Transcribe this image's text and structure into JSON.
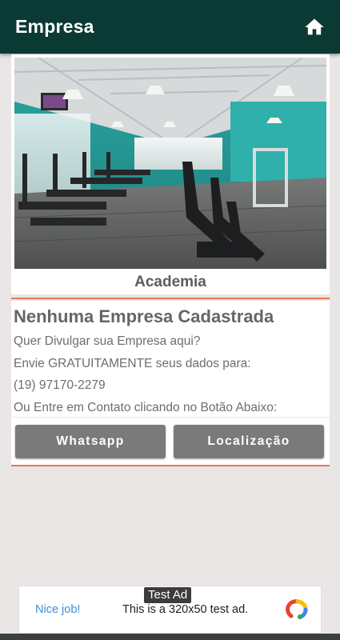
{
  "app": {
    "title": "Empresa",
    "home_icon": "home-icon"
  },
  "card": {
    "caption": "Academia"
  },
  "info": {
    "title": "Nenhuma Empresa Cadastrada",
    "lines": [
      "Quer Divulgar sua Empresa aqui?",
      "Envie GRATUITAMENTE seus dados para:",
      "(19) 97170-2279",
      "Ou Entre em Contato clicando no Botão Abaixo:"
    ]
  },
  "buttons": {
    "whatsapp": "Whatsapp",
    "location": "Localização"
  },
  "ad": {
    "label": "Test Ad",
    "nice": "Nice job!",
    "text": "This is a 320x50 test ad.",
    "logo_icon": "ad-logo-icon"
  },
  "colors": {
    "appbar": "#0b3a34",
    "background": "#e9e6e5",
    "button": "#7a7a7a",
    "accent_line": "#e07a5a"
  }
}
